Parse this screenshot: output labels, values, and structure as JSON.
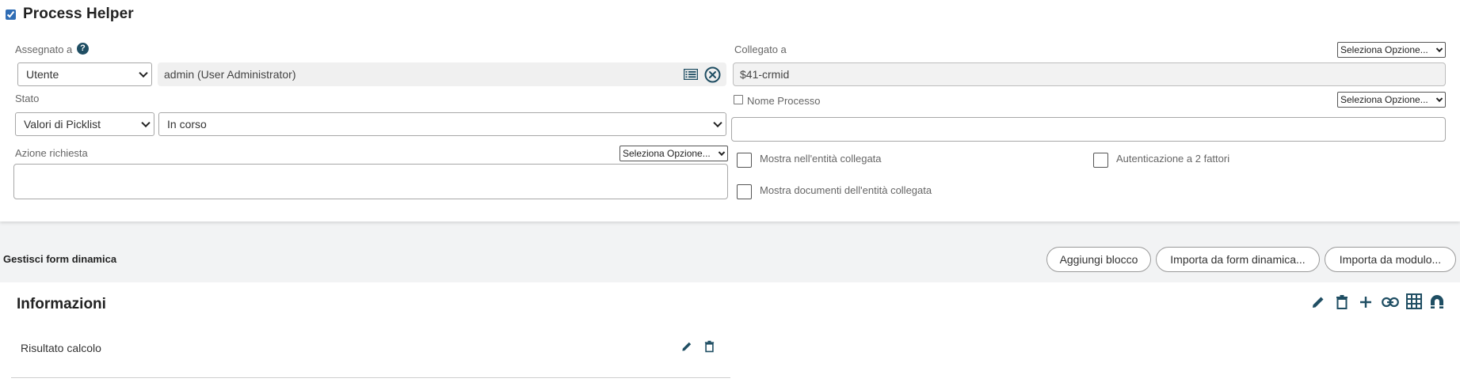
{
  "header": {
    "title": "Process Helper",
    "checked": true
  },
  "assigned": {
    "label": "Assegnato a",
    "help_icon": "question-circle-icon",
    "type_value": "Utente",
    "user_value": "admin (User Administrator)",
    "list_icon": "list-icon",
    "clear_icon": "clear-circle-icon"
  },
  "linked": {
    "label": "Collegato a",
    "option_select": "Seleziona Opzione...",
    "value": "$41-crmid"
  },
  "status": {
    "label": "Stato",
    "type_value": "Valori di Picklist",
    "value": "In corso"
  },
  "process_name": {
    "label": "Nome Processo",
    "option_select": "Seleziona Opzione...",
    "value": ""
  },
  "action": {
    "label": "Azione richiesta",
    "option_select": "Seleziona Opzione...",
    "value": ""
  },
  "checks": {
    "show_in_entity": "Mostra nell'entità collegata",
    "two_factor": "Autenticazione a 2 fattori",
    "show_documents": "Mostra documenti dell'entità collegata"
  },
  "dynamic_form": {
    "label": "Gestisci form dinamica",
    "add_block": "Aggiungi blocco",
    "import_form": "Importa da form dinamica...",
    "import_module": "Importa da modulo..."
  },
  "block": {
    "title": "Informazioni",
    "tools": [
      "pencil-icon",
      "trash-icon",
      "plus-icon",
      "link-icon",
      "table-icon",
      "magnet-icon"
    ],
    "rows": [
      {
        "label": "Risultato calcolo"
      }
    ]
  },
  "colors": {
    "icon": "#1f4e63",
    "accent": "#2f6db5"
  }
}
